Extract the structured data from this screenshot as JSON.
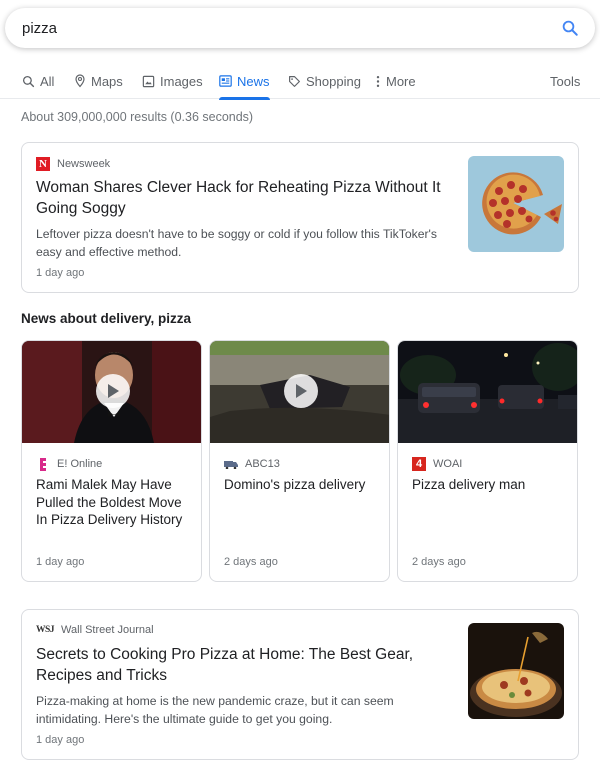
{
  "search": {
    "query": "pizza"
  },
  "tabs": [
    {
      "label": "All"
    },
    {
      "label": "Maps"
    },
    {
      "label": "Images"
    },
    {
      "label": "News"
    },
    {
      "label": "Shopping"
    },
    {
      "label": "More"
    }
  ],
  "tools_label": "Tools",
  "result_stats": "About 309,000,000 results (0.36 seconds)",
  "top_story": {
    "source": "Newsweek",
    "source_logo_letter": "N",
    "title": "Woman Shares Clever Hack for Reheating Pizza Without It Going Soggy",
    "snippet": "Leftover pizza doesn't have to be soggy or cold if you follow this TikToker's easy and effective method.",
    "age": "1 day ago"
  },
  "section_title": "News about delivery, pizza",
  "mini_cards": [
    {
      "source": "E! Online",
      "title": "Rami Malek May Have Pulled the Boldest Move In Pizza Delivery History",
      "age": "1 day ago"
    },
    {
      "source": "ABC13",
      "title": "Domino's pizza delivery",
      "age": "2 days ago"
    },
    {
      "source": "WOAI",
      "source_logo_text": "4",
      "title": "Pizza delivery man",
      "age": "2 days ago"
    }
  ],
  "bottom_story": {
    "source": "Wall Street Journal",
    "source_logo_text": "WSJ",
    "title": "Secrets to Cooking Pro Pizza at Home: The Best Gear, Recipes and Tricks",
    "snippet": "Pizza-making at home is the new pandemic craze, but it can seem intimidating. Here's the ultimate guide to get you going.",
    "age": "1 day ago"
  },
  "colors": {
    "accent": "#1a73e8",
    "newsweek_red": "#e01c24",
    "eonline_pink": "#d82a8a",
    "woai_red": "#d7261e"
  }
}
